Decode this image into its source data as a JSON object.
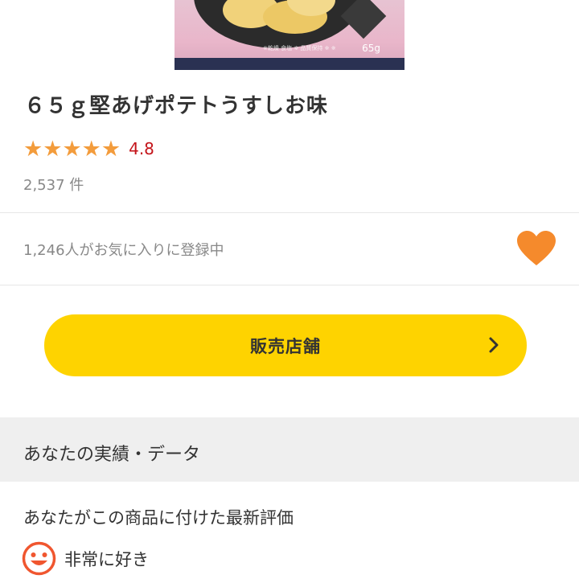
{
  "product": {
    "image": {
      "weight_label": "65g",
      "fineprint": "※乾燥 食塩 ※ 品質保持 ※ ※"
    },
    "title": "６５ｇ堅あげポテトうすしお味",
    "rating": {
      "stars": 5,
      "value": "4.8"
    },
    "review_count": "2,537 件"
  },
  "favorites": {
    "text": "1,246人がお気に入りに登録中",
    "heart_color": "#f58a2c"
  },
  "shop_button": {
    "label": "販売店舗"
  },
  "your_data": {
    "header": "あなたの実績・データ",
    "latest_label": "あなたがこの商品に付けた最新評価",
    "evaluation": "非常に好き"
  },
  "colors": {
    "accent_yellow": "#fed300",
    "star_orange": "#f39c3c",
    "rating_red": "#c4141a"
  }
}
